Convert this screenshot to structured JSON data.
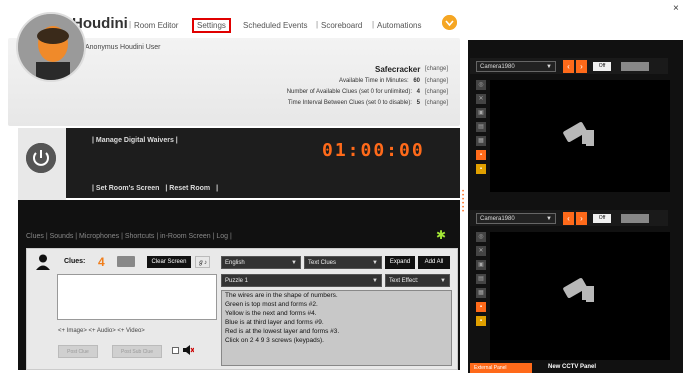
{
  "header": {
    "app_title": "Houdini",
    "nav": [
      {
        "label": "Room Editor"
      },
      {
        "label": "Settings"
      },
      {
        "label": "Scheduled Events"
      },
      {
        "label": "Scoreboard"
      },
      {
        "label": "Automations"
      }
    ],
    "close": "×"
  },
  "user": {
    "name": "Anonymus Houdini User"
  },
  "room": {
    "name": "Safecracker",
    "change_label": "[change]",
    "rows": [
      {
        "label": "Available Time in Minutes:",
        "value": "60"
      },
      {
        "label": "Number of Available Clues (set 0 for unlimited):",
        "value": "4"
      },
      {
        "label": "Time Interval Between Clues (set 0 to disable):",
        "value": "5"
      }
    ]
  },
  "controls": {
    "manage_waivers": "| Manage Digital Waivers |",
    "set_screen": "| Set Room's Screen",
    "reset_room": "| Reset Room",
    "reset_sep": "|",
    "timer": "01:00:00"
  },
  "tabs": {
    "text": "Clues |  Sounds |  Microphones |  Shortcuts |  in-Room Screen |  Log |"
  },
  "clues": {
    "label": "Clues:",
    "count": "4",
    "clear_screen": "Clear Screen",
    "audio_icon_label": "ℊ♪",
    "attach": "<+ Image>   <+ Audio>   <+ Video>",
    "post_clue": "Post Clue",
    "post_sub_clue": "Post Sub Clue",
    "language": "English",
    "type": "Text Clues",
    "expand": "Expand",
    "add_all": "Add All",
    "puzzle": "Puzzle 1",
    "text_effect": "Text Effect:",
    "list": [
      "The wires are in the shape of numbers.",
      "Green is top most and forms #2.",
      "Yellow is the next and forms #4.",
      "Blue is at third layer and forms #9.",
      "Red is at the lowest layer and forms #3.",
      "Click on 2 4 9 3 screws (keypads)."
    ]
  },
  "cameras": [
    {
      "name": "Camera1980",
      "toggle": "Off"
    },
    {
      "name": "Camera1980",
      "toggle": "Off"
    }
  ],
  "cctv": {
    "external_panel": "External Panel",
    "new_cctv": "New CCTV Panel"
  },
  "colors": {
    "accent": "#ff6a1a",
    "highlight": "#e00000"
  }
}
